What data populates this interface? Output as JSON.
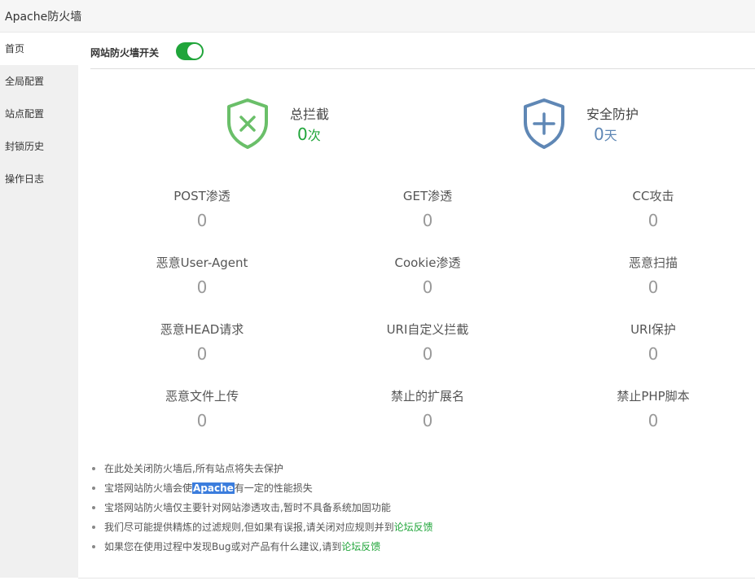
{
  "app": {
    "title": "Apache防火墙"
  },
  "sidebar": {
    "items": [
      {
        "label": "首页",
        "active": true
      },
      {
        "label": "全局配置"
      },
      {
        "label": "站点配置"
      },
      {
        "label": "封锁历史"
      },
      {
        "label": "操作日志"
      }
    ]
  },
  "switch": {
    "label": "网站防火墙开关",
    "enabled": true,
    "color": "#20a53a"
  },
  "summary": {
    "total_block": {
      "label": "总拦截",
      "value": "0",
      "unit": "次",
      "color": "#20a53a",
      "icon": "shield-x-icon"
    },
    "protection": {
      "label": "安全防护",
      "value": "0",
      "unit": "天",
      "color": "#5f87b5",
      "icon": "shield-plus-icon"
    }
  },
  "stats": [
    {
      "label": "POST渗透",
      "value": "0"
    },
    {
      "label": "GET渗透",
      "value": "0"
    },
    {
      "label": "CC攻击",
      "value": "0"
    },
    {
      "label": "恶意User-Agent",
      "value": "0"
    },
    {
      "label": "Cookie渗透",
      "value": "0"
    },
    {
      "label": "恶意扫描",
      "value": "0"
    },
    {
      "label": "恶意HEAD请求",
      "value": "0"
    },
    {
      "label": "URI自定义拦截",
      "value": "0"
    },
    {
      "label": "URI保护",
      "value": "0"
    },
    {
      "label": "恶意文件上传",
      "value": "0"
    },
    {
      "label": "禁止的扩展名",
      "value": "0"
    },
    {
      "label": "禁止PHP脚本",
      "value": "0"
    }
  ],
  "tips": {
    "t1": "在此处关闭防火墙后,所有站点将失去保护",
    "t2_pre": "宝塔网站防火墙会使",
    "t2_hl": "Apache",
    "t2_post": "有一定的性能损失",
    "t3": "宝塔网站防火墙仅主要针对网站渗透攻击,暂时不具备系统加固功能",
    "t4_pre": "我们尽可能提供精炼的过滤规则,但如果有误报,请关闭对应规则并到",
    "t4_link": "论坛反馈",
    "t5_pre": "如果您在使用过程中发现Bug或对产品有什么建议,请到",
    "t5_link": "论坛反馈"
  }
}
